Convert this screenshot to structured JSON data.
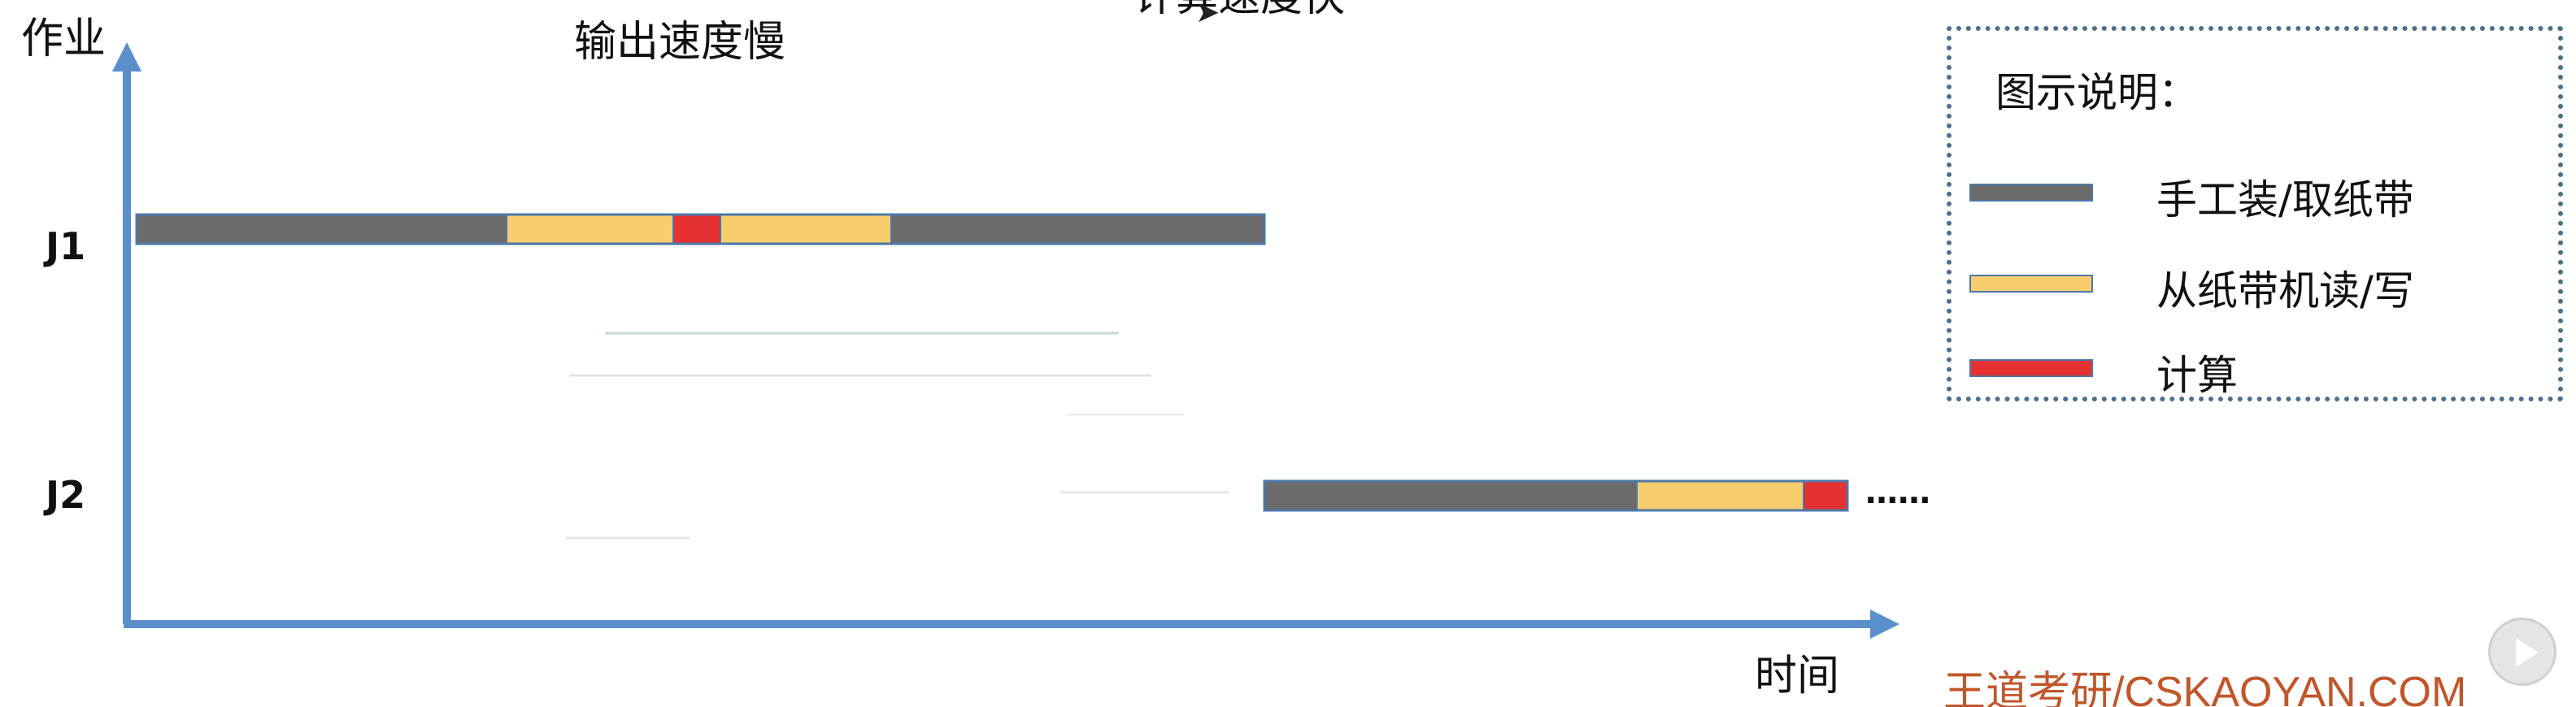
{
  "header_text": {
    "top_left_partial": "",
    "output_speed": "输出速度慢",
    "compute_speed_partial": "计算速度快"
  },
  "axes": {
    "y_label": "作业",
    "x_label": "时间"
  },
  "jobs": [
    {
      "label": "J1",
      "segments": [
        {
          "type": "manual",
          "start": 0,
          "end": 455
        },
        {
          "type": "tape",
          "start": 455,
          "end": 660
        },
        {
          "type": "compute",
          "start": 660,
          "end": 718
        },
        {
          "type": "tape",
          "start": 718,
          "end": 928
        },
        {
          "type": "manual",
          "start": 928,
          "end": 1387
        }
      ]
    },
    {
      "label": "J2",
      "segments": [
        {
          "type": "manual",
          "start": 1387,
          "end": 1845
        },
        {
          "type": "tape",
          "start": 1845,
          "end": 2050
        },
        {
          "type": "compute",
          "start": 2050,
          "end": 2104
        }
      ],
      "continuation": "……"
    }
  ],
  "legend": {
    "title": "图示说明：",
    "items": [
      {
        "type": "manual",
        "label": "手工装/取纸带",
        "color": "#6b6b6b"
      },
      {
        "type": "tape",
        "label": "从纸带机读/写",
        "color": "#f7cd6d"
      },
      {
        "type": "compute",
        "label": "计算",
        "color": "#e53131"
      }
    ]
  },
  "colors": {
    "axis": "#5b8fcc",
    "bar_border": "#4d78a8"
  },
  "watermark": "王道考研/CSKAOYAN.COM",
  "icons": {
    "sidebar_button": "play-circle-icon"
  }
}
